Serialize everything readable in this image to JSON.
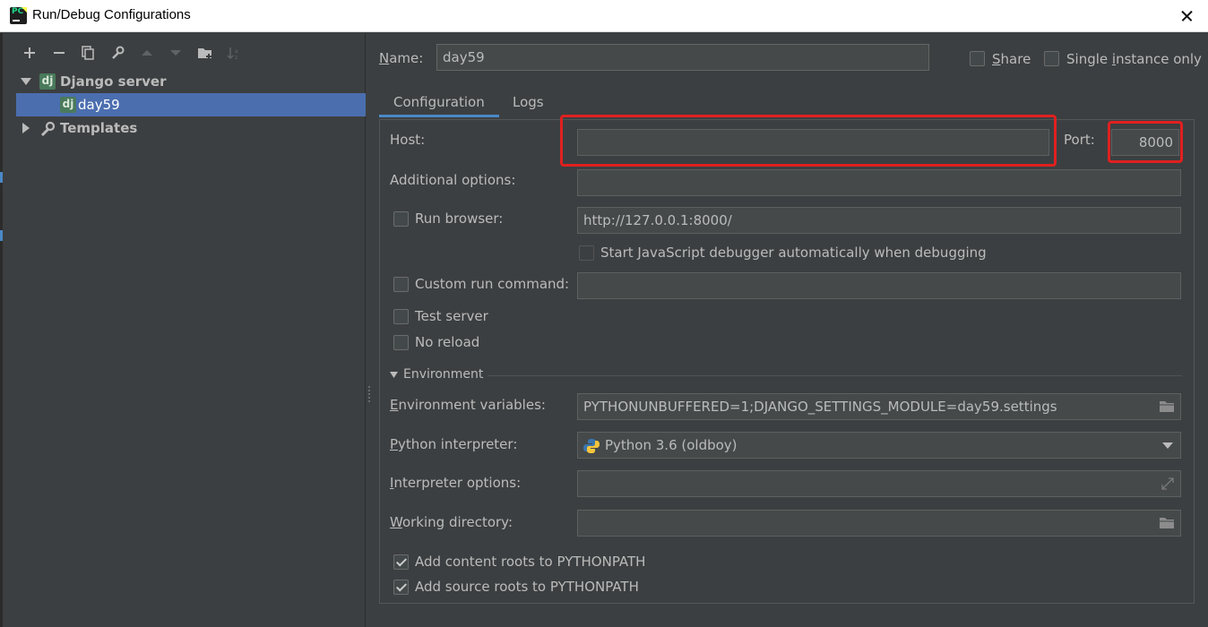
{
  "window": {
    "title": "Run/Debug Configurations"
  },
  "icons": {
    "app": "pycharm-icon",
    "close": "close-icon",
    "add": "plus-icon",
    "remove": "minus-icon",
    "copy": "copy-icon",
    "edit_defaults": "wrench-icon",
    "move_up": "arrow-up-icon",
    "move_down": "arrow-down-icon",
    "folder": "folder-icon",
    "sort": "sort-icon"
  },
  "tree": {
    "group_label": "Django server",
    "group_icon_text": "dj",
    "config_label": "day59",
    "config_icon_text": "dj",
    "templates_label": "Templates"
  },
  "header": {
    "name_label_u": "N",
    "name_label_rest": "ame:",
    "name_value": "day59",
    "share_label_u": "S",
    "share_label_rest": "hare",
    "single_label_pre": "Single ",
    "single_label_u": "i",
    "single_label_rest": "nstance only"
  },
  "tabs": [
    {
      "label": "Configuration",
      "active": true
    },
    {
      "label": "Logs",
      "active": false
    }
  ],
  "config": {
    "host_label": "Host:",
    "host_value": "",
    "port_label": "Port:",
    "port_value": "8000",
    "additional_label": "Additional options:",
    "additional_value": "",
    "run_browser_label": "Run browser:",
    "run_browser_url": "http://127.0.0.1:8000/",
    "js_debugger_label": "Start JavaScript debugger automatically when debugging",
    "custom_cmd_label": "Custom run command:",
    "custom_cmd_value": "",
    "test_server_label": "Test server",
    "no_reload_label": "No reload",
    "environment_section": "Environment",
    "env_vars_label_u": "E",
    "env_vars_label_rest": "nvironment variables:",
    "env_vars_value": "PYTHONUNBUFFERED=1;DJANGO_SETTINGS_MODULE=day59.settings",
    "interpreter_label_u": "P",
    "interpreter_label_rest": "ython interpreter:",
    "interpreter_value": "Python 3.6 (oldboy)",
    "interp_options_label_u": "I",
    "interp_options_label_rest": "nterpreter options:",
    "interp_options_value": "",
    "working_dir_label_u": "W",
    "working_dir_label_rest": "orking directory:",
    "working_dir_value": "",
    "content_roots_label": "Add content roots to PYTHONPATH",
    "source_roots_label": "Add source roots to PYTHONPATH"
  },
  "colors": {
    "background": "#3c3f41",
    "selection": "#4b6eaf",
    "tab_underline": "#4a88c7",
    "highlight_box": "#e02020"
  }
}
